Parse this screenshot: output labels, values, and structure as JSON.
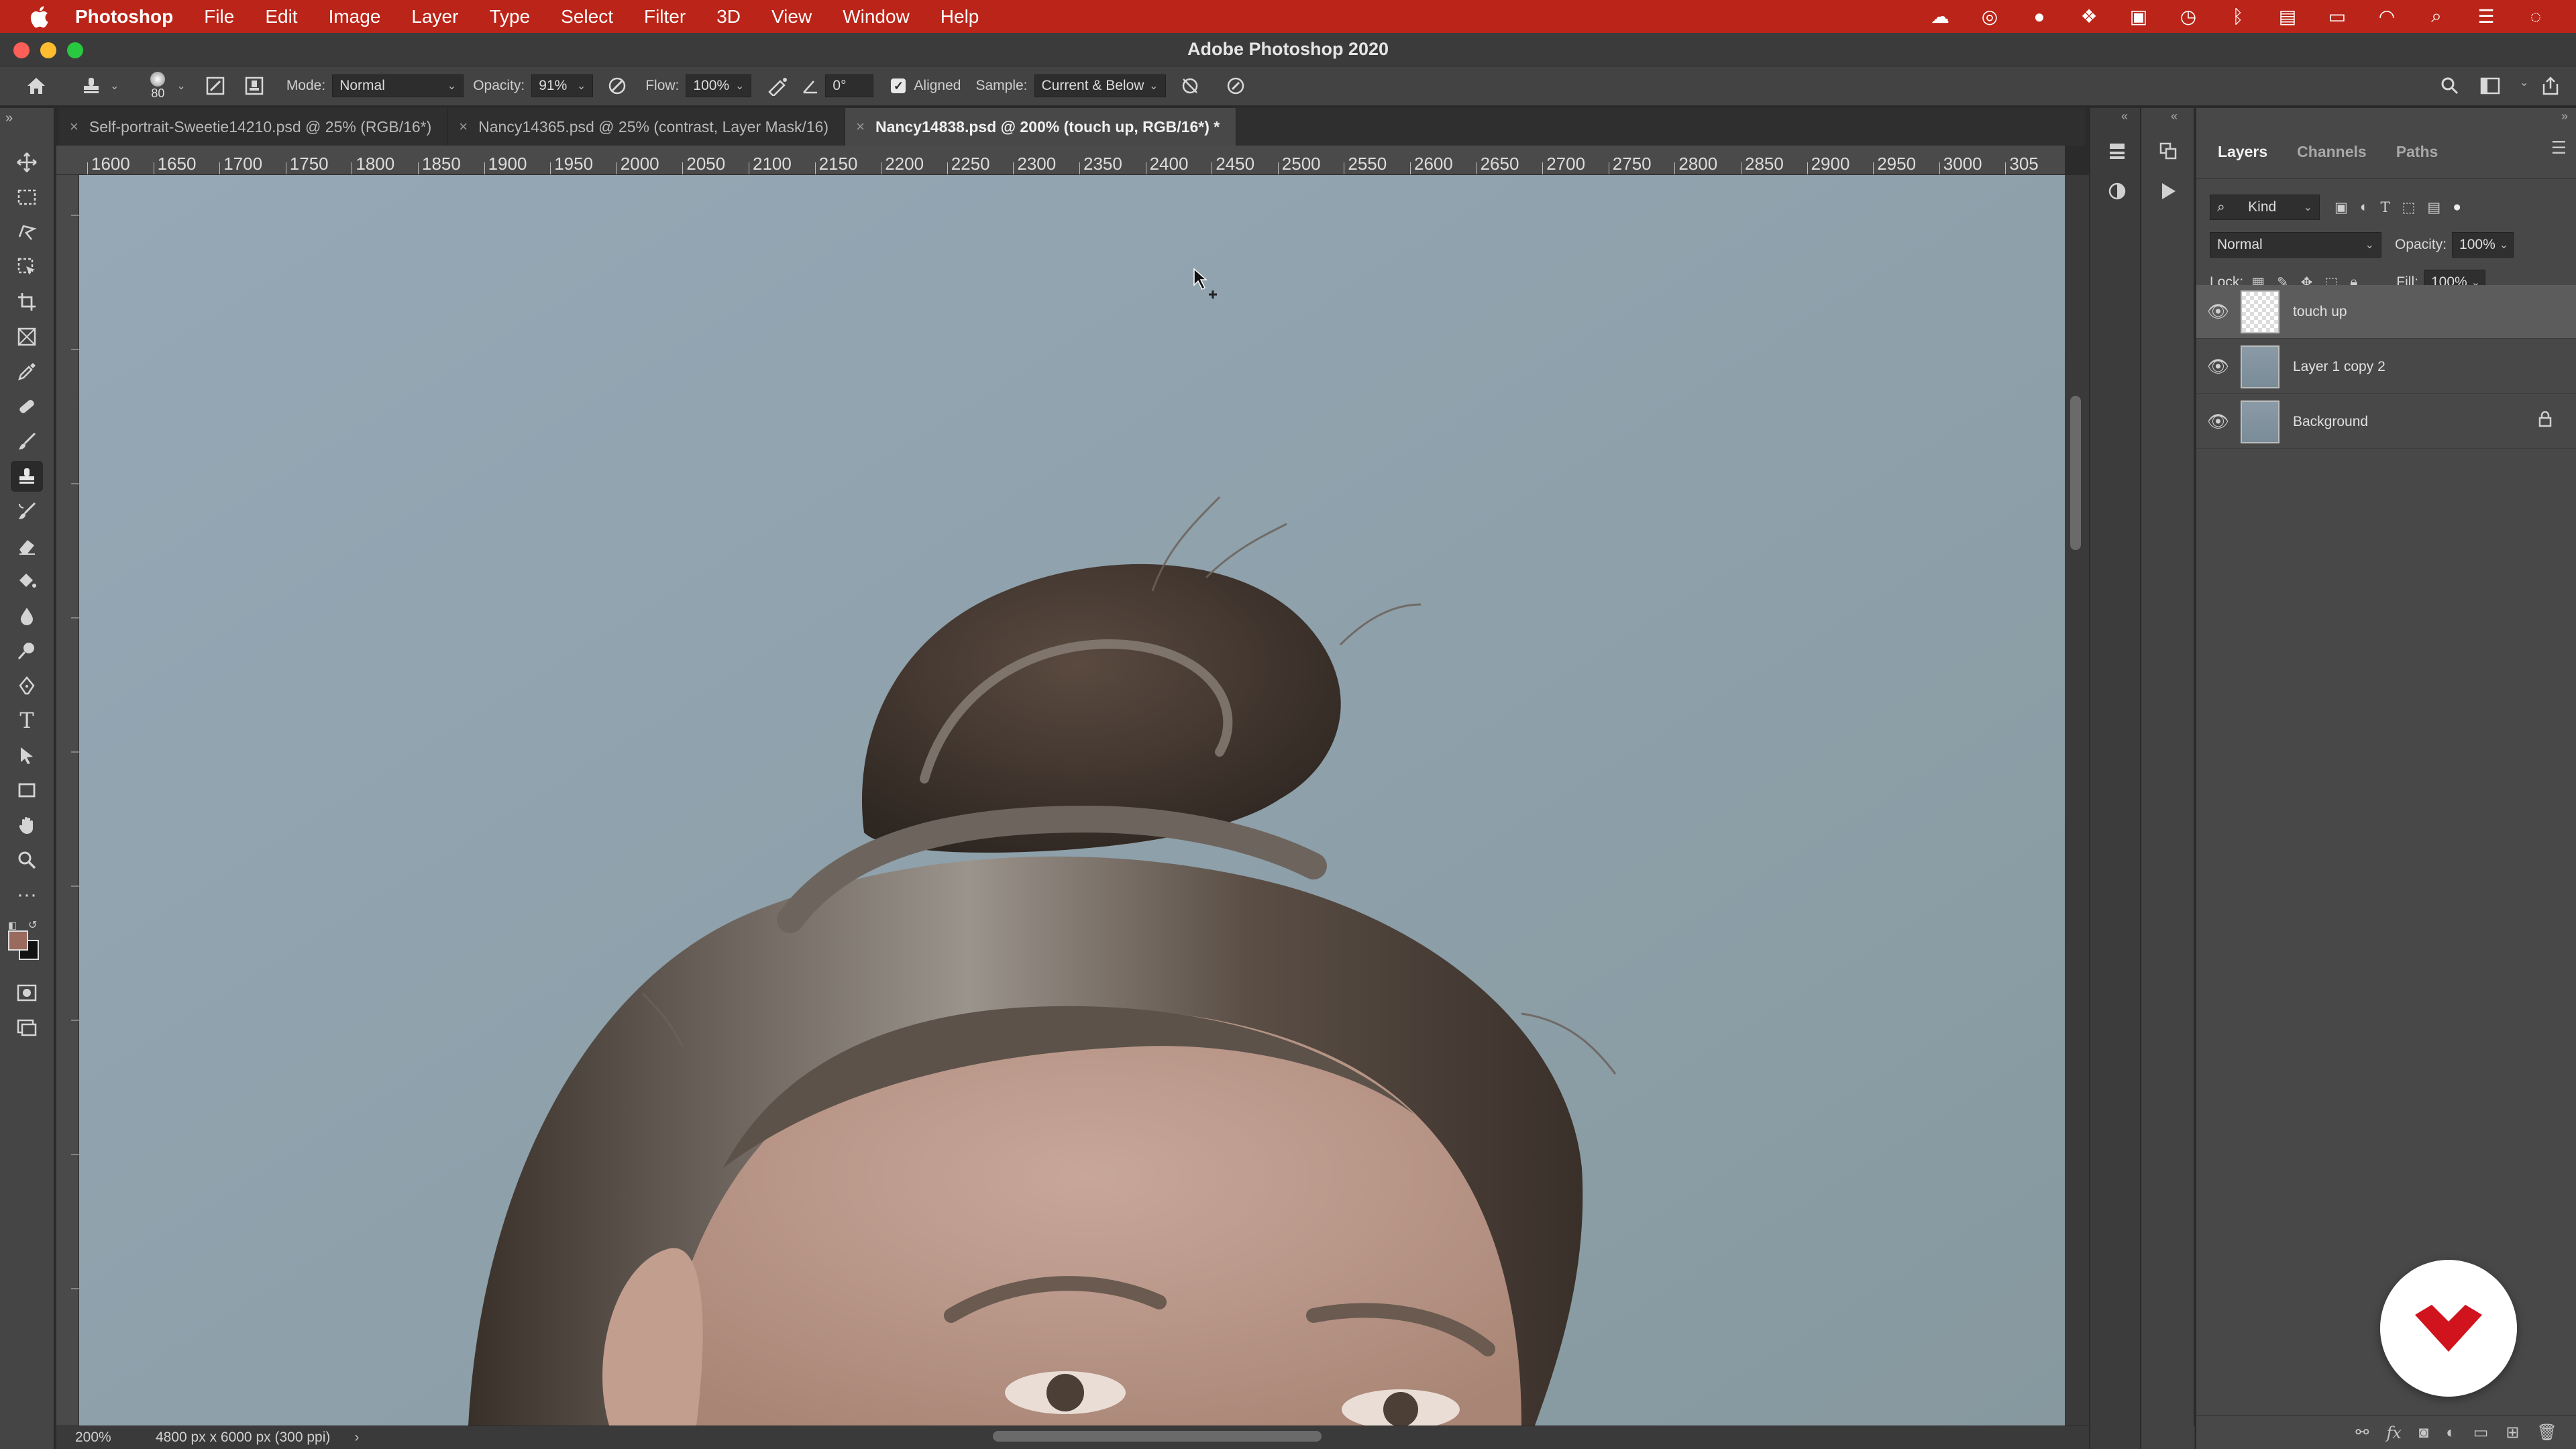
{
  "menubar": {
    "app_name": "Photoshop",
    "items": [
      "File",
      "Edit",
      "Image",
      "Layer",
      "Type",
      "Select",
      "Filter",
      "3D",
      "View",
      "Window",
      "Help"
    ]
  },
  "window": {
    "title": "Adobe Photoshop 2020"
  },
  "options_bar": {
    "brush_size": "80",
    "mode_label": "Mode:",
    "mode_value": "Normal",
    "opacity_label": "Opacity:",
    "opacity_value": "91%",
    "flow_label": "Flow:",
    "flow_value": "100%",
    "angle_value": "0°",
    "aligned_label": "Aligned",
    "aligned_checked": true,
    "sample_label": "Sample:",
    "sample_value": "Current & Below"
  },
  "tabs": [
    {
      "label": "Self-portrait-Sweetie14210.psd @ 25% (RGB/16*)",
      "active": false
    },
    {
      "label": "Nancy14365.psd @ 25% (contrast, Layer Mask/16)",
      "active": false
    },
    {
      "label": "Nancy14838.psd @ 200% (touch up, RGB/16*) *",
      "active": true
    }
  ],
  "ruler": {
    "ticks": [
      "1600",
      "1650",
      "1700",
      "1750",
      "1800",
      "1850",
      "1900",
      "1950",
      "2000",
      "2050",
      "2100",
      "2150",
      "2200",
      "2250",
      "2300",
      "2350",
      "2400",
      "2450",
      "2500",
      "2550",
      "2600",
      "2650",
      "2700",
      "2750",
      "2800",
      "2850",
      "2900",
      "2950",
      "3000",
      "305"
    ]
  },
  "statusbar": {
    "zoom": "200%",
    "dimensions": "4800 px x 6000 px (300 ppi)"
  },
  "layers_panel": {
    "tabs": [
      "Layers",
      "Channels",
      "Paths"
    ],
    "active_tab": "Layers",
    "filter_kind": "Kind",
    "blend_mode": "Normal",
    "opacity_label": "Opacity:",
    "opacity_value": "100%",
    "lock_label": "Lock:",
    "fill_label": "Fill:",
    "fill_value": "100%",
    "layers": [
      {
        "name": "touch up",
        "selected": true,
        "locked": false
      },
      {
        "name": "Layer 1 copy 2",
        "selected": false,
        "locked": false
      },
      {
        "name": "Background",
        "selected": false,
        "locked": true
      }
    ]
  },
  "colors": {
    "menubar_bg": "#bb2418",
    "canvas_bg": "#8ea1b0",
    "badge_red": "#d0131c",
    "foreground_swatch": "#9a6a5e",
    "background_swatch": "#111111"
  }
}
